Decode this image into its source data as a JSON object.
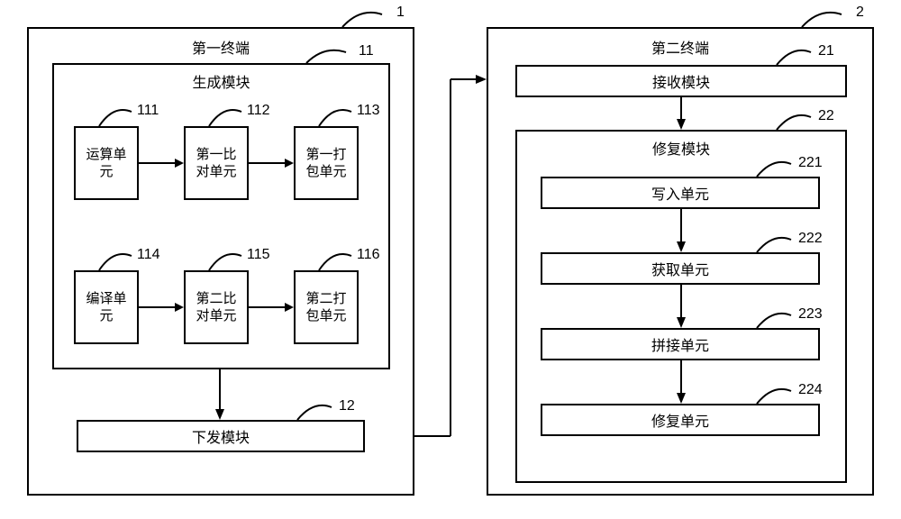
{
  "terminal1": {
    "label": "第一终端",
    "num": "1",
    "gen_module": {
      "label": "生成模块",
      "num": "11",
      "units": {
        "u111": {
          "label": "运算单\n元",
          "num": "111"
        },
        "u112": {
          "label": "第一比\n对单元",
          "num": "112"
        },
        "u113": {
          "label": "第一打\n包单元",
          "num": "113"
        },
        "u114": {
          "label": "编译单\n元",
          "num": "114"
        },
        "u115": {
          "label": "第二比\n对单元",
          "num": "115"
        },
        "u116": {
          "label": "第二打\n包单元",
          "num": "116"
        }
      }
    },
    "send_module": {
      "label": "下发模块",
      "num": "12"
    }
  },
  "terminal2": {
    "label": "第二终端",
    "num": "2",
    "recv_module": {
      "label": "接收模块",
      "num": "21"
    },
    "repair_module": {
      "label": "修复模块",
      "num": "22",
      "units": {
        "u221": {
          "label": "写入单元",
          "num": "221"
        },
        "u222": {
          "label": "获取单元",
          "num": "222"
        },
        "u223": {
          "label": "拼接单元",
          "num": "223"
        },
        "u224": {
          "label": "修复单元",
          "num": "224"
        }
      }
    }
  }
}
